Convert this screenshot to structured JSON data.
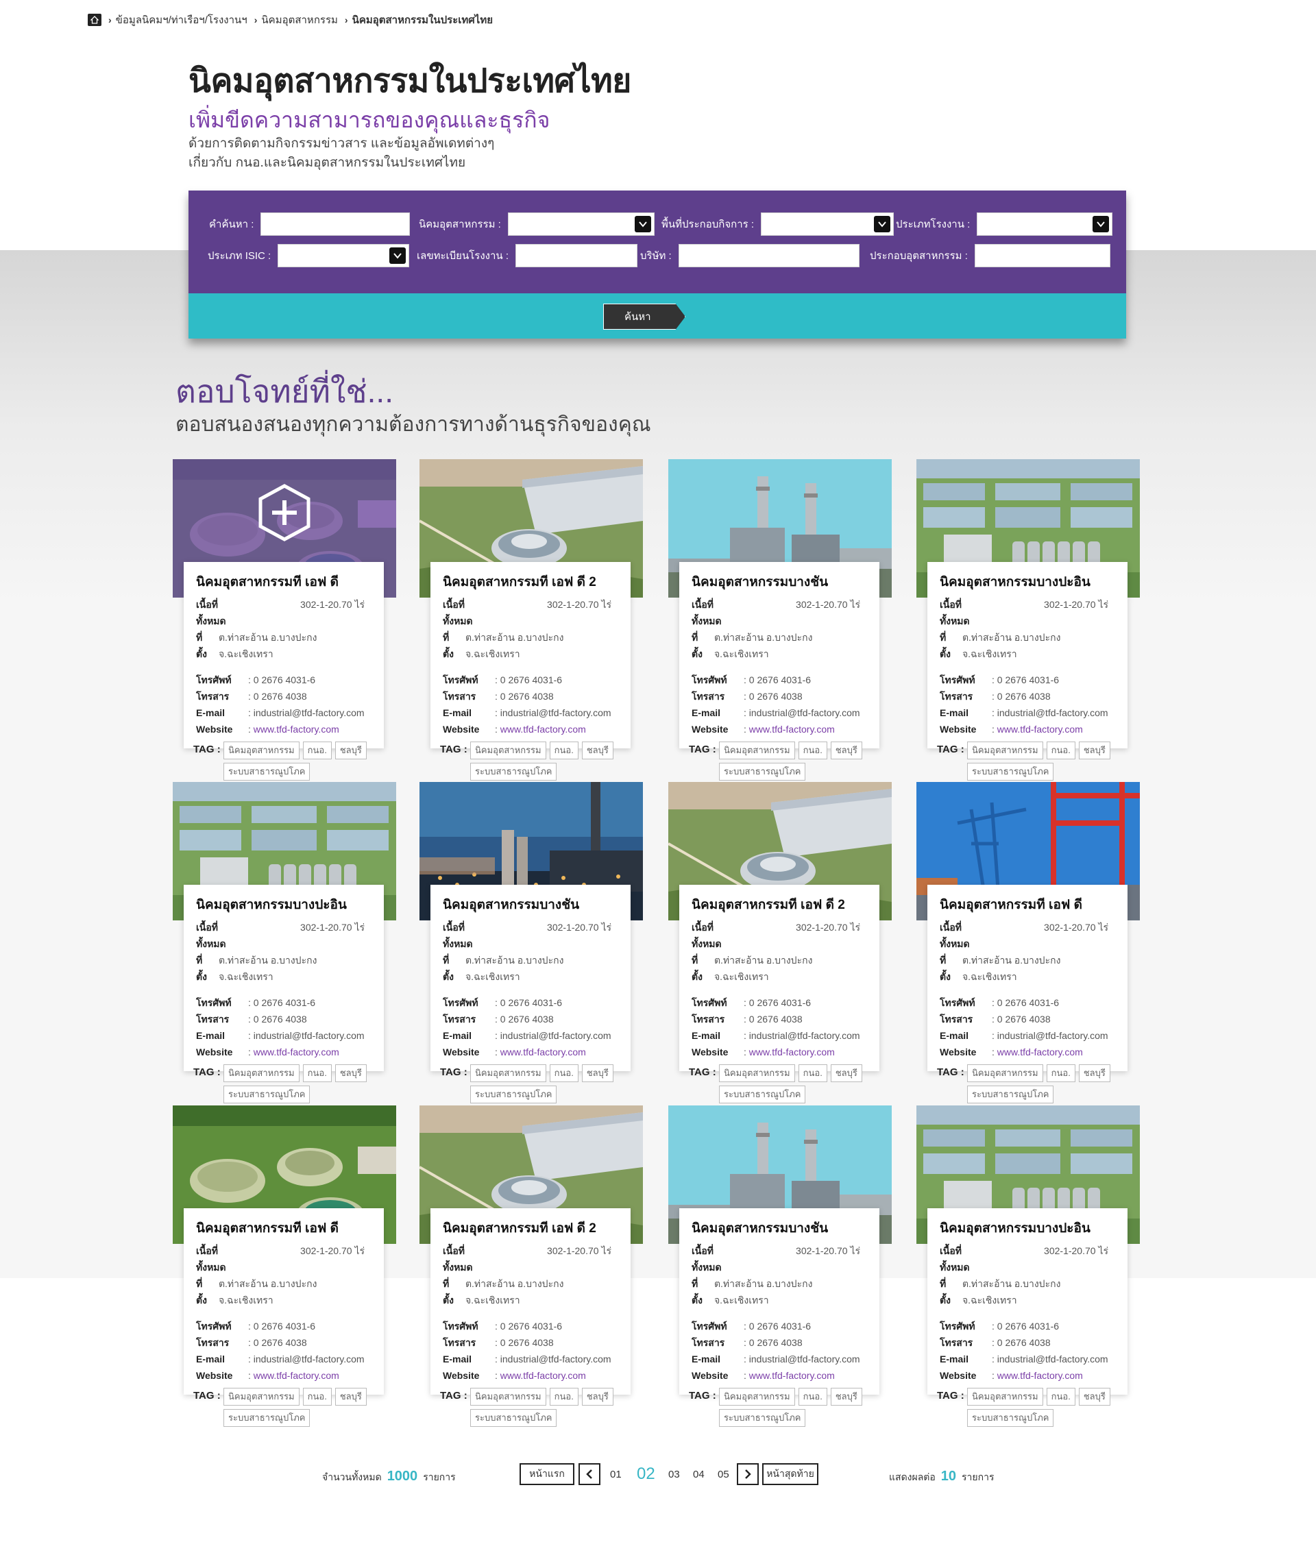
{
  "breadcrumb": {
    "home_icon": "home-icon",
    "items": [
      "ข้อมูลนิคมฯ/ท่าเรือฯ/โรงงานฯ",
      "นิคมอุตสาหกรรม",
      "นิคมอุตสาหกรรมในประเทศไทย"
    ]
  },
  "header": {
    "title": "นิคมอุตสาหกรรมในประเทศไทย",
    "subtitle": "เพิ่มขีดความสามารถของคุณและธุรกิจ",
    "desc_line1": "ด้วยการติดตามกิจกรรมข่าวสาร และข้อมูลอัพเดทต่างๆ",
    "desc_line2": "เกี่ยวกับ กนอ.และนิคมอุตสาหกรรมในประเทศไทย"
  },
  "search": {
    "keyword_label": "คำค้นหา :",
    "estate_label": "นิคมอุตสาหกรรม :",
    "zone_label": "พื้นที่ประกอบกิจการ :",
    "factory_type_label": "ประเภทโรงงาน :",
    "isic_label": "ประเภท ISIC :",
    "reg_no_label": "เลขทะเบียนโรงงาน :",
    "company_label": "บริษัท :",
    "operator_label": "ประกอบอุตสาหกรรม :",
    "button_label": "ค้นหา"
  },
  "section": {
    "title": "ตอบโจทย์ที่ใช่...",
    "subtitle": "ตอบสนองสนองทุกความต้องการทางด้านธุรกิจของคุณ"
  },
  "card_labels": {
    "area_label": "เนื้อที่ทั้งหมด",
    "location_label": "ที่ตั้ง",
    "phone_label": "โทรศัพท์",
    "fax_label": "โทรสาร",
    "email_label": "E-mail",
    "website_label": "Website",
    "tag_label": "TAG :"
  },
  "cards": [
    {
      "name": "นิคมอุตสาหกรรมที เอฟ ดี",
      "area": "302-1-20.70 ไร่",
      "location": "ต.ท่าสะอ้าน อ.บางปะกง จ.ฉะเชิงเทรา",
      "phone": ": 0 2676 4031-6",
      "fax": ": 0 2676 4038",
      "email": ": industrial@tfd-factory.com",
      "website": "www.tfd-factory.com",
      "tags": [
        "นิคมอุตสาหกรรม",
        "กนอ.",
        "ชลบุรี",
        "ระบบสาธารณูปโภค"
      ],
      "image": "biogas-tanks",
      "overlay": "plus-hexagon-icon"
    },
    {
      "name": "นิคมอุตสาหกรรมที เอฟ ดี 2",
      "area": "302-1-20.70 ไร่",
      "location": "ต.ท่าสะอ้าน อ.บางปะกง จ.ฉะเชิงเทรา",
      "phone": ": 0 2676 4031-6",
      "fax": ": 0 2676 4038",
      "email": ": industrial@tfd-factory.com",
      "website": "www.tfd-factory.com",
      "tags": [
        "นิคมอุตสาหกรรม",
        "กนอ.",
        "ชลบุรี",
        "ระบบสาธารณูปโภค"
      ],
      "image": "round-building"
    },
    {
      "name": "นิคมอุตสาหกรรมบางชัน",
      "area": "302-1-20.70 ไร่",
      "location": "ต.ท่าสะอ้าน อ.บางปะกง จ.ฉะเชิงเทรา",
      "phone": ": 0 2676 4031-6",
      "fax": ": 0 2676 4038",
      "email": ": industrial@tfd-factory.com",
      "website": "www.tfd-factory.com",
      "tags": [
        "นิคมอุตสาหกรรม",
        "กนอ.",
        "ชลบุรี",
        "ระบบสาธารณูปโภค"
      ],
      "image": "power-plant"
    },
    {
      "name": "นิคมอุตสาหกรรมบางปะอิน",
      "area": "302-1-20.70 ไร่",
      "location": "ต.ท่าสะอ้าน อ.บางปะกง จ.ฉะเชิงเทรา",
      "phone": ": 0 2676 4031-6",
      "fax": ": 0 2676 4038",
      "email": ": industrial@tfd-factory.com",
      "website": "www.tfd-factory.com",
      "tags": [
        "นิคมอุตสาหกรรม",
        "กนอ.",
        "ชลบุรี",
        "ระบบสาธารณูปโภค"
      ],
      "image": "silos-fields"
    },
    {
      "name": "นิคมอุตสาหกรรมบางปะอิน",
      "area": "302-1-20.70 ไร่",
      "location": "ต.ท่าสะอ้าน อ.บางปะกง จ.ฉะเชิงเทรา",
      "phone": ": 0 2676 4031-6",
      "fax": ": 0 2676 4038",
      "email": ": industrial@tfd-factory.com",
      "website": "www.tfd-factory.com",
      "tags": [
        "นิคมอุตสาหกรรม",
        "กนอ.",
        "ชลบุรี",
        "ระบบสาธารณูปโภค"
      ],
      "image": "silos-fields"
    },
    {
      "name": "นิคมอุตสาหกรรมบางชัน",
      "area": "302-1-20.70 ไร่",
      "location": "ต.ท่าสะอ้าน อ.บางปะกง จ.ฉะเชิงเทรา",
      "phone": ": 0 2676 4031-6",
      "fax": ": 0 2676 4038",
      "email": ": industrial@tfd-factory.com",
      "website": "www.tfd-factory.com",
      "tags": [
        "นิคมอุตสาหกรรม",
        "กนอ.",
        "ชลบุรี",
        "ระบบสาธารณูปโภค"
      ],
      "image": "refinery-dusk"
    },
    {
      "name": "นิคมอุตสาหกรรมที เอฟ ดี 2",
      "area": "302-1-20.70 ไร่",
      "location": "ต.ท่าสะอ้าน อ.บางปะกง จ.ฉะเชิงเทรา",
      "phone": ": 0 2676 4031-6",
      "fax": ": 0 2676 4038",
      "email": ": industrial@tfd-factory.com",
      "website": "www.tfd-factory.com",
      "tags": [
        "นิคมอุตสาหกรรม",
        "กนอ.",
        "ชลบุรี",
        "ระบบสาธารณูปโภค"
      ],
      "image": "round-building"
    },
    {
      "name": "นิคมอุตสาหกรรมที เอฟ ดี",
      "area": "302-1-20.70 ไร่",
      "location": "ต.ท่าสะอ้าน อ.บางปะกง จ.ฉะเชิงเทรา",
      "phone": ": 0 2676 4031-6",
      "fax": ": 0 2676 4038",
      "email": ": industrial@tfd-factory.com",
      "website": "www.tfd-factory.com",
      "tags": [
        "นิคมอุตสาหกรรม",
        "กนอ.",
        "ชลบุรี",
        "ระบบสาธารณูปโภค"
      ],
      "image": "port-cranes"
    },
    {
      "name": "นิคมอุตสาหกรรมที เอฟ ดี",
      "area": "302-1-20.70 ไร่",
      "location": "ต.ท่าสะอ้าน อ.บางปะกง จ.ฉะเชิงเทรา",
      "phone": ": 0 2676 4031-6",
      "fax": ": 0 2676 4038",
      "email": ": industrial@tfd-factory.com",
      "website": "www.tfd-factory.com",
      "tags": [
        "นิคมอุตสาหกรรม",
        "กนอ.",
        "ชลบุรี",
        "ระบบสาธารณูปโภค"
      ],
      "image": "biogas-tanks"
    },
    {
      "name": "นิคมอุตสาหกรรมที เอฟ ดี 2",
      "area": "302-1-20.70 ไร่",
      "location": "ต.ท่าสะอ้าน อ.บางปะกง จ.ฉะเชิงเทรา",
      "phone": ": 0 2676 4031-6",
      "fax": ": 0 2676 4038",
      "email": ": industrial@tfd-factory.com",
      "website": "www.tfd-factory.com",
      "tags": [
        "นิคมอุตสาหกรรม",
        "กนอ.",
        "ชลบุรี",
        "ระบบสาธารณูปโภค"
      ],
      "image": "round-building"
    },
    {
      "name": "นิคมอุตสาหกรรมบางชัน",
      "area": "302-1-20.70 ไร่",
      "location": "ต.ท่าสะอ้าน อ.บางปะกง จ.ฉะเชิงเทรา",
      "phone": ": 0 2676 4031-6",
      "fax": ": 0 2676 4038",
      "email": ": industrial@tfd-factory.com",
      "website": "www.tfd-factory.com",
      "tags": [
        "นิคมอุตสาหกรรม",
        "กนอ.",
        "ชลบุรี",
        "ระบบสาธารณูปโภค"
      ],
      "image": "power-plant"
    },
    {
      "name": "นิคมอุตสาหกรรมบางปะอิน",
      "area": "302-1-20.70 ไร่",
      "location": "ต.ท่าสะอ้าน อ.บางปะกง จ.ฉะเชิงเทรา",
      "phone": ": 0 2676 4031-6",
      "fax": ": 0 2676 4038",
      "email": ": industrial@tfd-factory.com",
      "website": "www.tfd-factory.com",
      "tags": [
        "นิคมอุตสาหกรรม",
        "กนอ.",
        "ชลบุรี",
        "ระบบสาธารณูปโภค"
      ],
      "image": "silos-fields"
    }
  ],
  "pagination": {
    "total_label": "จำนวนทั้งหมด",
    "total_value": "1000",
    "total_unit": "รายการ",
    "first_label": "หน้าแรก",
    "last_label": "หน้าสุดท้าย",
    "pages": [
      "01",
      "02",
      "03",
      "04",
      "05"
    ],
    "current_page": "02",
    "per_page_label": "แสดงผลต่อ",
    "per_page_value": "10",
    "per_page_unit": "รายการ"
  },
  "colors": {
    "brand_purple": "#5e3f8c",
    "accent_teal": "#2fbcc7",
    "link_purple": "#7b3fa8",
    "page_number_teal": "#37b6c5"
  }
}
